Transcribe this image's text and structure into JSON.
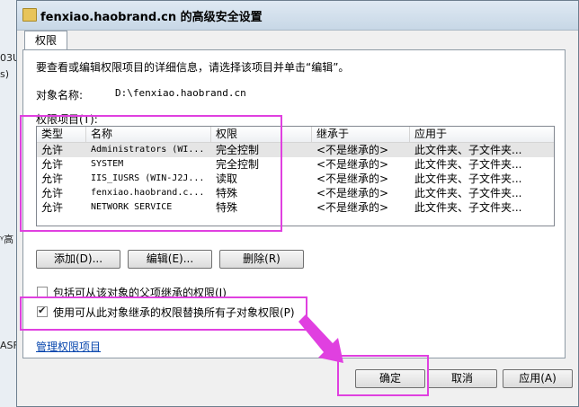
{
  "background": {
    "left_fragments": [
      "03U",
      "s)",
      "ᵞ高",
      "ASF"
    ]
  },
  "dialog": {
    "title": "fenxiao.haobrand.cn 的高级安全设置",
    "tab": "权限",
    "description": "要查看或编辑权限项目的详细信息，请选择该项目并单击“编辑”。",
    "object_name_label": "对象名称:",
    "object_name_value": "D:\\fenxiao.haobrand.cn",
    "permission_entries_label": "权限项目(T):",
    "columns": [
      "类型",
      "名称",
      "权限",
      "继承于",
      "应用于"
    ],
    "rows": [
      {
        "type": "允许",
        "name": "Administrators (WI...",
        "perm": "完全控制",
        "inherit": "<不是继承的>",
        "apply": "此文件夹、子文件夹..."
      },
      {
        "type": "允许",
        "name": "SYSTEM",
        "perm": "完全控制",
        "inherit": "<不是继承的>",
        "apply": "此文件夹、子文件夹..."
      },
      {
        "type": "允许",
        "name": "IIS_IUSRS (WIN-J2J...",
        "perm": "读取",
        "inherit": "<不是继承的>",
        "apply": "此文件夹、子文件夹..."
      },
      {
        "type": "允许",
        "name": "fenxiao.haobrand.c...",
        "perm": "特殊",
        "inherit": "<不是继承的>",
        "apply": "此文件夹、子文件夹..."
      },
      {
        "type": "允许",
        "name": "NETWORK SERVICE",
        "perm": "特殊",
        "inherit": "<不是继承的>",
        "apply": "此文件夹、子文件夹..."
      }
    ],
    "buttons": {
      "add": "添加(D)...",
      "edit": "编辑(E)...",
      "remove": "删除(R)",
      "ok": "确定",
      "cancel": "取消",
      "apply": "应用(A)"
    },
    "checkbox_inherit": {
      "label": "包括可从该对象的父项继承的权限(I)",
      "checked": false
    },
    "checkbox_replace": {
      "label": "使用可从此对象继承的权限替换所有子对象权限(P)",
      "checked": true
    },
    "manage_link": "管理权限项目",
    "annotation_color": "#e040e0"
  }
}
